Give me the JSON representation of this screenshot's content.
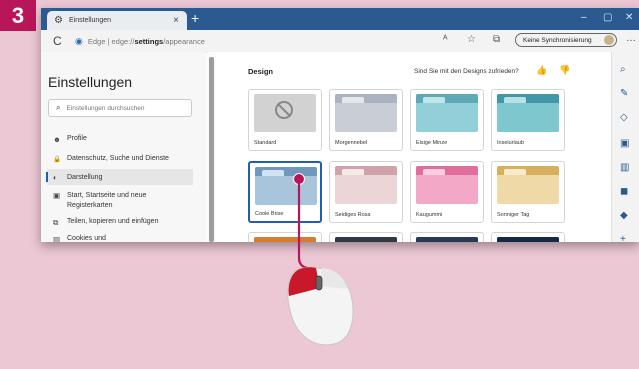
{
  "step": "3",
  "colors": {
    "accent": "#b9165a",
    "titlebar": "#2a5a8f",
    "selection": "#1f5fb0"
  },
  "browser": {
    "tab_title": "Einstellungen",
    "tab_close": "×",
    "new_tab": "+",
    "window_controls": {
      "minimize": "–",
      "maximize": "▢",
      "close": "✕"
    },
    "refresh": "C",
    "address": {
      "prefix": "Edge  |  edge://",
      "bold": "settings",
      "suffix": "/appearance"
    },
    "sync_label": "Keine Synchronisierung",
    "more": "…"
  },
  "sidebar": {
    "title": "Einstellungen",
    "search_placeholder": "Einstellungen durchsuchen",
    "items": [
      {
        "label": "Profile",
        "icon": "person-icon",
        "glyph": "☻"
      },
      {
        "label": "Datenschutz, Suche und Dienste",
        "icon": "lock-icon",
        "glyph": "🔒"
      },
      {
        "label": "Darstellung",
        "icon": "appearance-icon",
        "glyph": "◐"
      },
      {
        "label": "Start, Startseite und neue Registerkarten",
        "icon": "tabs-icon",
        "glyph": "▣"
      },
      {
        "label": "Teilen, kopieren und einfügen",
        "icon": "share-icon",
        "glyph": "⧉"
      },
      {
        "label": "Cookies und",
        "icon": "cookies-icon",
        "glyph": "▤"
      }
    ]
  },
  "main": {
    "title": "Design",
    "feedback": "Sind Sie mit den Designs zufrieden?",
    "like": "👍",
    "dislike": "👎",
    "themes": [
      {
        "name": "Standard"
      },
      {
        "name": "Morgennebel",
        "color": "#c9ced6",
        "accent": "#aab3bf"
      },
      {
        "name": "Eisige Minze",
        "color": "#92cfd8",
        "accent": "#5fa9b6"
      },
      {
        "name": "Inselurlaub",
        "color": "#7fc7cf",
        "accent": "#3f97a8"
      },
      {
        "name": "Coole Brise",
        "color": "#a9c5dc",
        "accent": "#6f98bb"
      },
      {
        "name": "Seidiges Rosa",
        "color": "#ecd5d7",
        "accent": "#cfa3a9"
      },
      {
        "name": "Kaugummi",
        "color": "#f4a8c7",
        "accent": "#e06d9c"
      },
      {
        "name": "Sonniger Tag",
        "color": "#efd9a6",
        "accent": "#d6b05a"
      },
      {
        "name": "",
        "color": "#f0a35a",
        "accent": "#d57e2e"
      },
      {
        "name": "",
        "color": "#4a5562",
        "accent": "#2f3944"
      },
      {
        "name": "",
        "color": "#3b4f6e",
        "accent": "#263a57"
      },
      {
        "name": "",
        "color": "#1e3b63",
        "accent": "#14294a"
      }
    ]
  },
  "rightbar_icons": [
    "search-icon",
    "tag-icon",
    "pen-icon",
    "briefcase-icon",
    "books-icon",
    "outlook-icon",
    "office-icon",
    "add-icon"
  ]
}
